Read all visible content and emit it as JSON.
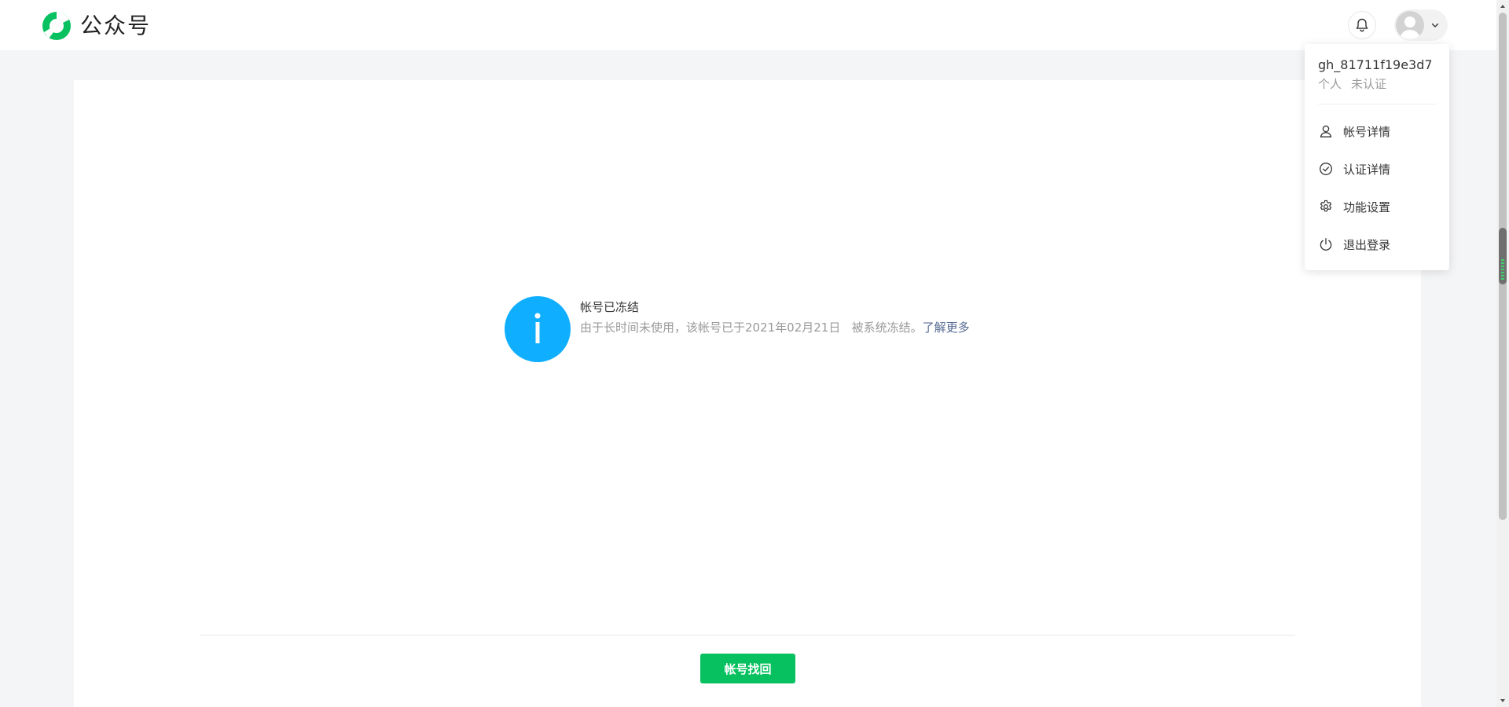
{
  "header": {
    "logo_text": "公众号",
    "logo_icon": "wechat-official-account-logo",
    "bell_icon": "bell-icon",
    "avatar_icon": "user-avatar",
    "chevron_icon": "chevron-down-icon"
  },
  "main": {
    "notice_icon": "info-icon",
    "title": "帐号已冻结",
    "description": "由于长时间未使用，该帐号已于2021年02月21日   被系统冻结。",
    "learn_more": "了解更多",
    "recover_button": "帐号找回"
  },
  "dropdown": {
    "account_id": "gh_81711f19e3d7",
    "account_type": "个人",
    "verification_status": "未认证",
    "items": [
      {
        "label": "帐号详情",
        "icon": "user-icon"
      },
      {
        "label": "认证详情",
        "icon": "check-circle-icon"
      },
      {
        "label": "功能设置",
        "icon": "gear-icon"
      },
      {
        "label": "退出登录",
        "icon": "power-icon"
      }
    ]
  },
  "colors": {
    "brand_green": "#07c160",
    "info_blue": "#10aeff",
    "link": "#576b95"
  }
}
